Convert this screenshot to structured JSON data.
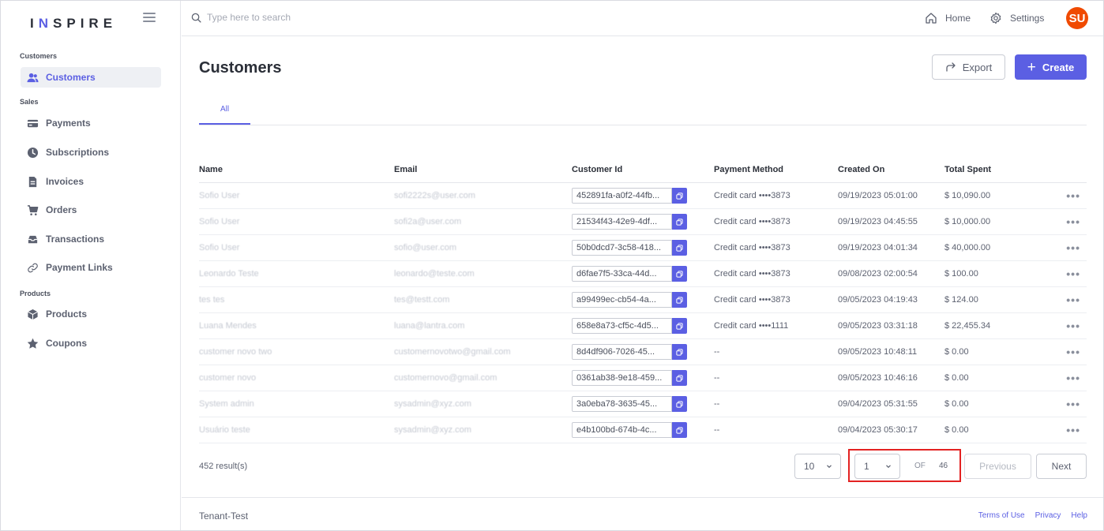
{
  "brand": {
    "prefix": "I",
    "accent_letter": "N",
    "suffix": "SPIRE"
  },
  "sidebar": {
    "sections": [
      {
        "label": "Customers",
        "items": [
          {
            "label": "Customers",
            "icon": "users-icon",
            "active": true
          }
        ]
      },
      {
        "label": "Sales",
        "items": [
          {
            "label": "Payments",
            "icon": "card-icon"
          },
          {
            "label": "Subscriptions",
            "icon": "clock-icon"
          },
          {
            "label": "Invoices",
            "icon": "document-icon"
          },
          {
            "label": "Orders",
            "icon": "cart-icon"
          },
          {
            "label": "Transactions",
            "icon": "inbox-icon"
          },
          {
            "label": "Payment Links",
            "icon": "link-icon"
          }
        ]
      },
      {
        "label": "Products",
        "items": [
          {
            "label": "Products",
            "icon": "box-icon"
          },
          {
            "label": "Coupons",
            "icon": "star-icon"
          }
        ]
      }
    ]
  },
  "topbar": {
    "search_placeholder": "Type here to search",
    "home_label": "Home",
    "settings_label": "Settings",
    "avatar_initials": "SU"
  },
  "page": {
    "title": "Customers",
    "export_label": "Export",
    "create_label": "Create",
    "tabs": [
      {
        "label": "All"
      }
    ]
  },
  "table": {
    "headers": {
      "name": "Name",
      "email": "Email",
      "customer_id": "Customer Id",
      "payment_method": "Payment Method",
      "created_on": "Created On",
      "total_spent": "Total Spent"
    },
    "rows": [
      {
        "name": "Sofio User",
        "email": "sofi2222s@user.com",
        "customer_id": "452891fa-a0f2-44fb...",
        "payment_method": "Credit card ••••3873",
        "created_on": "09/19/2023 05:01:00",
        "total_spent": "$ 10,090.00"
      },
      {
        "name": "Sofio User",
        "email": "sofi2a@user.com",
        "customer_id": "21534f43-42e9-4df...",
        "payment_method": "Credit card ••••3873",
        "created_on": "09/19/2023 04:45:55",
        "total_spent": "$ 10,000.00"
      },
      {
        "name": "Sofio User",
        "email": "sofio@user.com",
        "customer_id": "50b0dcd7-3c58-418...",
        "payment_method": "Credit card ••••3873",
        "created_on": "09/19/2023 04:01:34",
        "total_spent": "$ 40,000.00"
      },
      {
        "name": "Leonardo Teste",
        "email": "leonardo@teste.com",
        "customer_id": "d6fae7f5-33ca-44d...",
        "payment_method": "Credit card ••••3873",
        "created_on": "09/08/2023 02:00:54",
        "total_spent": "$ 100.00"
      },
      {
        "name": "tes tes",
        "email": "tes@testt.com",
        "customer_id": "a99499ec-cb54-4a...",
        "payment_method": "Credit card ••••3873",
        "created_on": "09/05/2023 04:19:43",
        "total_spent": "$ 124.00"
      },
      {
        "name": "Luana Mendes",
        "email": "luana@lantra.com",
        "customer_id": "658e8a73-cf5c-4d5...",
        "payment_method": "Credit card ••••1111",
        "created_on": "09/05/2023 03:31:18",
        "total_spent": "$ 22,455.34"
      },
      {
        "name": "customer novo two",
        "email": "customernovotwo@gmail.com",
        "customer_id": "8d4df906-7026-45...",
        "payment_method": "--",
        "created_on": "09/05/2023 10:48:11",
        "total_spent": "$ 0.00"
      },
      {
        "name": "customer novo",
        "email": "customernovo@gmail.com",
        "customer_id": "0361ab38-9e18-459...",
        "payment_method": "--",
        "created_on": "09/05/2023 10:46:16",
        "total_spent": "$ 0.00"
      },
      {
        "name": "System admin",
        "email": "sysadmin@xyz.com",
        "customer_id": "3a0eba78-3635-45...",
        "payment_method": "--",
        "created_on": "09/04/2023 05:31:55",
        "total_spent": "$ 0.00"
      },
      {
        "name": "Usuário teste",
        "email": "sysadmin@xyz.com",
        "customer_id": "e4b100bd-674b-4c...",
        "payment_method": "--",
        "created_on": "09/04/2023 05:30:17",
        "total_spent": "$ 0.00"
      }
    ]
  },
  "pagination": {
    "results_text": "452 result(s)",
    "page_size": "10",
    "current_page": "1",
    "of_label": "OF",
    "total_pages": "46",
    "previous_label": "Previous",
    "next_label": "Next"
  },
  "footer": {
    "tenant": "Tenant-Test",
    "links": [
      "Terms of Use",
      "Privacy",
      "Help"
    ]
  },
  "colors": {
    "accent": "#5b5fe3",
    "avatar": "#f04a00",
    "highlight": "#e32222"
  }
}
